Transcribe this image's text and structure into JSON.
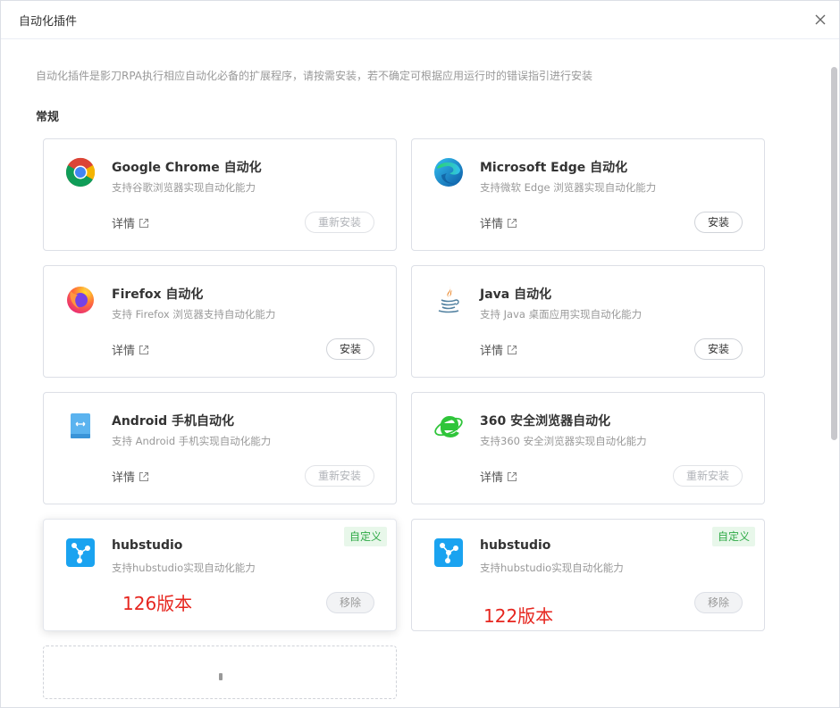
{
  "dialog": {
    "title": "自动化插件"
  },
  "description": "自动化插件是影刀RPA执行相应自动化必备的扩展程序，请按需安装，若不确定可根据应用运行时的错误指引进行安装",
  "section_title": "常规",
  "detail_label": "详情",
  "cards": [
    {
      "title": "Google Chrome 自动化",
      "subtitle": "支持谷歌浏览器实现自动化能力",
      "action": "重新安装",
      "icon": "chrome-icon"
    },
    {
      "title": "Microsoft Edge 自动化",
      "subtitle": "支持微软 Edge 浏览器实现自动化能力",
      "action": "安装",
      "icon": "edge-icon"
    },
    {
      "title": "Firefox 自动化",
      "subtitle": "支持 Firefox 浏览器支持自动化能力",
      "action": "安装",
      "icon": "firefox-icon"
    },
    {
      "title": "Java 自动化",
      "subtitle": "支持 Java 桌面应用实现自动化能力",
      "action": "安装",
      "icon": "java-icon"
    },
    {
      "title": "Android 手机自动化",
      "subtitle": "支持 Android 手机实现自动化能力",
      "action": "重新安装",
      "icon": "android-icon"
    },
    {
      "title": "360 安全浏览器自动化",
      "subtitle": "支持360 安全浏览器实现自动化能力",
      "action": "重新安装",
      "icon": "360-browser-icon"
    },
    {
      "title": "hubstudio",
      "subtitle": "支持hubstudio实现自动化能力",
      "action": "移除",
      "tag": "自定义",
      "annotation": "126版本",
      "icon": "hubstudio-icon"
    },
    {
      "title": "hubstudio",
      "subtitle": "支持hubstudio实现自动化能力",
      "action": "移除",
      "tag": "自定义",
      "annotation": "122版本",
      "icon": "hubstudio-icon"
    }
  ],
  "colors": {
    "tag_green": "#2faa47",
    "annotation_red": "#e6261f",
    "hubstudio_blue": "#1aa3f0"
  }
}
